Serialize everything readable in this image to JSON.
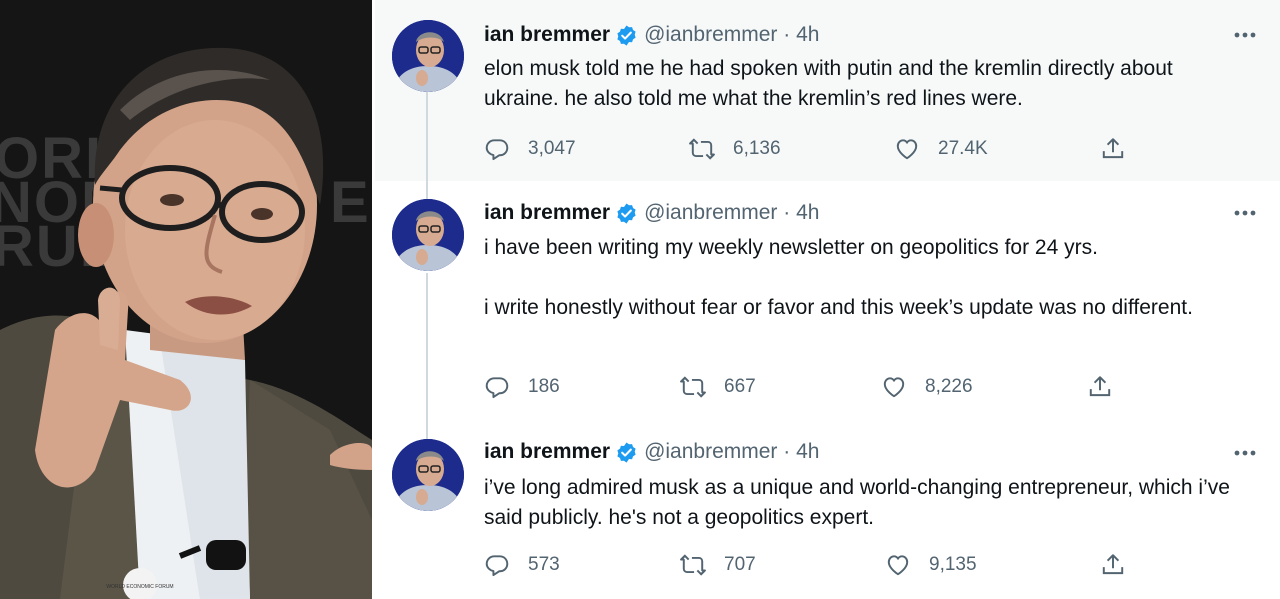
{
  "photo": {
    "backdrop_letters": [
      "ORL",
      "NOM",
      "RUM",
      "EC"
    ],
    "badge_text": "WORLD ECONOMIC FORUM"
  },
  "tweets": [
    {
      "author": "ian bremmer",
      "handle_time": "@ianbremmer · 4h",
      "text": [
        "elon musk told me he had spoken with putin and the kremlin directly about ukraine. he also told me what the kremlin’s red lines were."
      ],
      "replies": "3,047",
      "retweets": "6,136",
      "likes": "27.4K"
    },
    {
      "author": "ian bremmer",
      "handle_time": "@ianbremmer · 4h",
      "text": [
        "i have been writing my weekly newsletter on geopolitics for 24 yrs.",
        "i write honestly without fear or favor and this week’s update was no different."
      ],
      "replies": "186",
      "retweets": "667",
      "likes": "8,226"
    },
    {
      "author": "ian bremmer",
      "handle_time": "@ianbremmer · 4h",
      "text": [
        "i’ve long admired musk as a unique and world-changing entrepreneur, which i’ve said publicly. he's not a geopolitics expert."
      ],
      "replies": "573",
      "retweets": "707",
      "likes": "9,135"
    }
  ],
  "icons": {
    "reply": "reply-icon",
    "retweet": "retweet-icon",
    "like": "heart-icon",
    "share": "share-icon",
    "more": "more-icon",
    "verified": "verified-badge-icon"
  },
  "colors": {
    "verified": "#1d9bf0",
    "secondary_text": "#536471",
    "thread_line": "#cfd9de",
    "highlight_bg": "#f7f9f9"
  }
}
